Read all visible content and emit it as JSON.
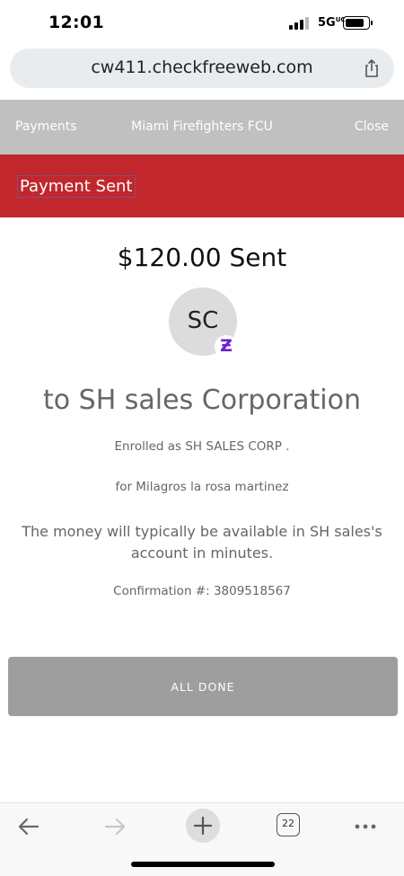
{
  "status_bar": {
    "time": "12:01",
    "network": "5G",
    "network_superscript": "UC",
    "battery_level": 0.85
  },
  "browser": {
    "url": "cw411.checkfreeweb.com",
    "share_icon": "share-icon",
    "toolbar": {
      "back_icon": "arrow-left-icon",
      "forward_icon": "arrow-right-icon",
      "new_tab_icon": "plus-icon",
      "tab_count": "22",
      "more_icon": "more-icon"
    }
  },
  "nav": {
    "payments": "Payments",
    "bank": "Miami Firefighters FCU",
    "close": "Close"
  },
  "banner": {
    "title": "Payment Sent",
    "color": "#c1272d"
  },
  "payment": {
    "amount_text": "$120.00 Sent",
    "avatar_initials": "SC",
    "badge_icon": "zelle-icon",
    "recipient_text": "to SH sales Corporation",
    "enrolled_text": "Enrolled as SH SALES CORP .",
    "for_text": "for Milagros la rosa martinez",
    "availability_text": "The money will typically be available in SH sales's account in minutes.",
    "confirmation_text": "Confirmation #: 3809518567"
  },
  "actions": {
    "done_label": "ALL DONE"
  }
}
